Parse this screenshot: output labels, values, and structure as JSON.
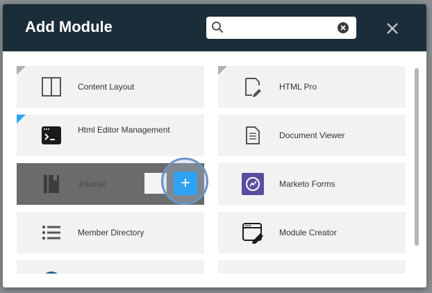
{
  "modal": {
    "title": "Add Module",
    "search": {
      "value": "",
      "placeholder": ""
    },
    "close_label": "×"
  },
  "modules": {
    "left": [
      {
        "label": "Content Layout",
        "icon": "content-layout-icon"
      },
      {
        "label": "Html Editor Management",
        "icon": "terminal-icon"
      },
      {
        "label": "Journal",
        "icon": "journal-icon"
      },
      {
        "label": "Member Directory",
        "icon": "list-icon"
      },
      {
        "label": "",
        "icon": "globe-icon"
      }
    ],
    "right": [
      {
        "label": "HTML Pro",
        "icon": "html-edit-icon"
      },
      {
        "label": "Document Viewer",
        "icon": "document-icon"
      },
      {
        "label": "Marketo Forms",
        "icon": "marketo-icon"
      },
      {
        "label": "Module Creator",
        "icon": "module-creator-icon"
      },
      {
        "label": "",
        "icon": "cloud-icon"
      }
    ]
  },
  "actions": {
    "add_label": "+"
  },
  "colors": {
    "header": "#1c2d3a",
    "tile": "#f2f2f2",
    "accent": "#2ea3f2",
    "hover_tile": "#6b6b6b",
    "marketo": "#5c4c9f"
  }
}
